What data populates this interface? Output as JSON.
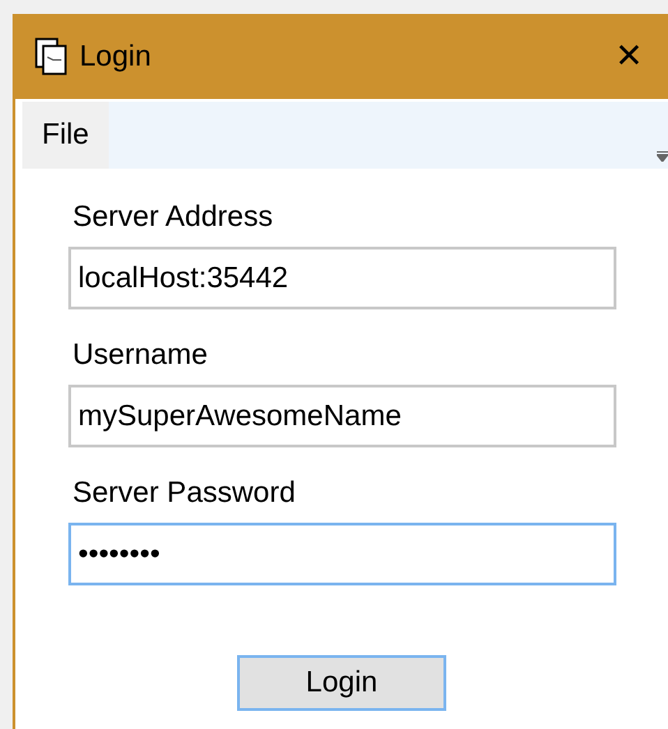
{
  "window": {
    "title": "Login",
    "close": "✕"
  },
  "menu": [
    {
      "label": "File"
    }
  ],
  "fields": [
    {
      "label": "Server Address",
      "value": "localHost:35442",
      "focused": false
    },
    {
      "label": "Username",
      "value": "mySuperAwesomeName",
      "focused": false
    },
    {
      "label": "Server Password",
      "value": "••••••••",
      "focused": true
    }
  ],
  "buttons": [
    "Login"
  ]
}
